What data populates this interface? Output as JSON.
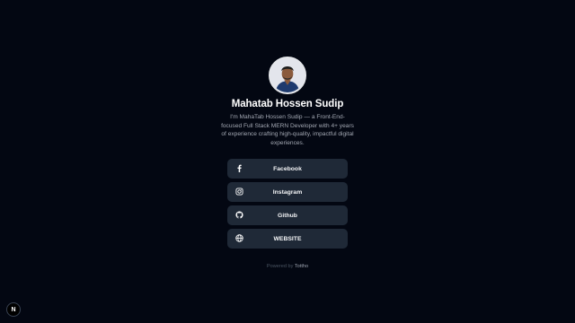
{
  "profile": {
    "name": "Mahatab Hossen Sudip",
    "bio": "I'm MahaTab Hossen Sudip — a Front-End-focused Full Stack MERN Developer with 4+ years of experience crafting high-quality, impactful digital experiences."
  },
  "links": [
    {
      "label": "Facebook",
      "icon": "facebook-icon"
    },
    {
      "label": "Instagram",
      "icon": "instagram-icon"
    },
    {
      "label": "Github",
      "icon": "github-icon"
    },
    {
      "label": "WEBSITE",
      "icon": "globe-icon"
    }
  ],
  "footer": {
    "powered_prefix": "Powered by",
    "brand": "Tottho"
  },
  "next_badge": {
    "letter": "N",
    "icon": "nextjs-icon"
  },
  "colors": {
    "background": "#030712",
    "button": "#1f2937",
    "text": "#ffffff",
    "muted": "#a3a8b3"
  }
}
